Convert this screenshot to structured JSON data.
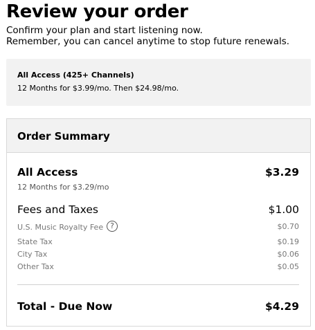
{
  "header": {
    "title": "Review your order",
    "intro_line1": "Confirm your plan and start listening now.",
    "intro_line2": "Remember, you can cancel anytime to stop future renewals."
  },
  "plan": {
    "name": "All Access (425+ Channels)",
    "price_text": "12 Months for $3.99/mo. Then $24.98/mo."
  },
  "summary": {
    "title": "Order Summary",
    "plan_label": "All Access",
    "plan_price": "$3.29",
    "plan_detail": "12 Months for $3.29/mo",
    "fees_label": "Fees and Taxes",
    "fees_total": "$1.00",
    "fees": [
      {
        "label": "U.S. Music Royalty Fee",
        "amount": "$0.70",
        "has_info": true
      },
      {
        "label": "State Tax",
        "amount": "$0.19"
      },
      {
        "label": "City Tax",
        "amount": "$0.06"
      },
      {
        "label": "Other Tax",
        "amount": "$0.05"
      }
    ],
    "total_label": "Total - Due Now",
    "total_amount": "$4.29",
    "info_icon_glyph": "?"
  }
}
